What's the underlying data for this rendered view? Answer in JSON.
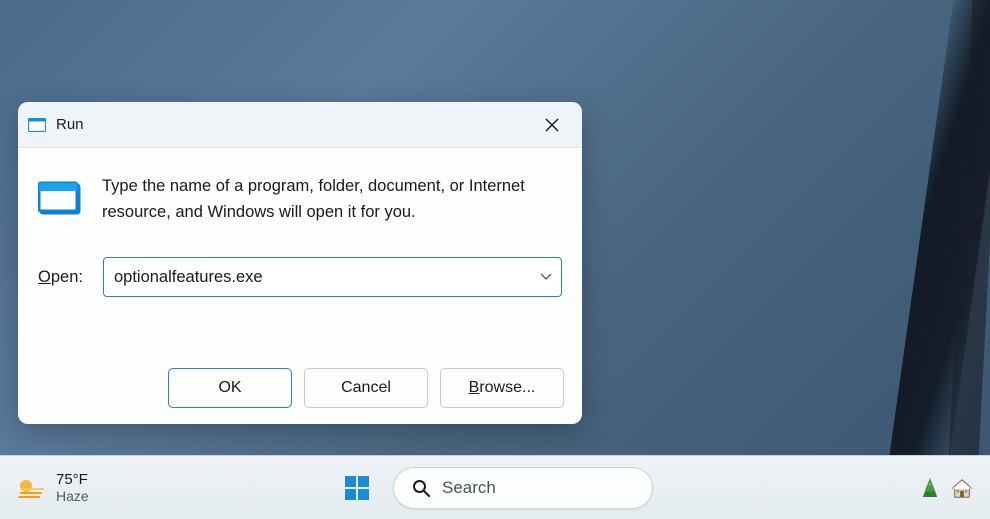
{
  "dialog": {
    "title": "Run",
    "description": "Type the name of a program, folder, document, or Internet resource, and Windows will open it for you.",
    "open_label_prefix": "O",
    "open_label_rest": "pen:",
    "input_value": "optionalfeatures.exe",
    "buttons": {
      "ok": "OK",
      "cancel": "Cancel",
      "browse_prefix": "B",
      "browse_rest": "rowse..."
    }
  },
  "taskbar": {
    "weather": {
      "temp": "75°F",
      "condition": "Haze"
    },
    "search_placeholder": "Search"
  }
}
